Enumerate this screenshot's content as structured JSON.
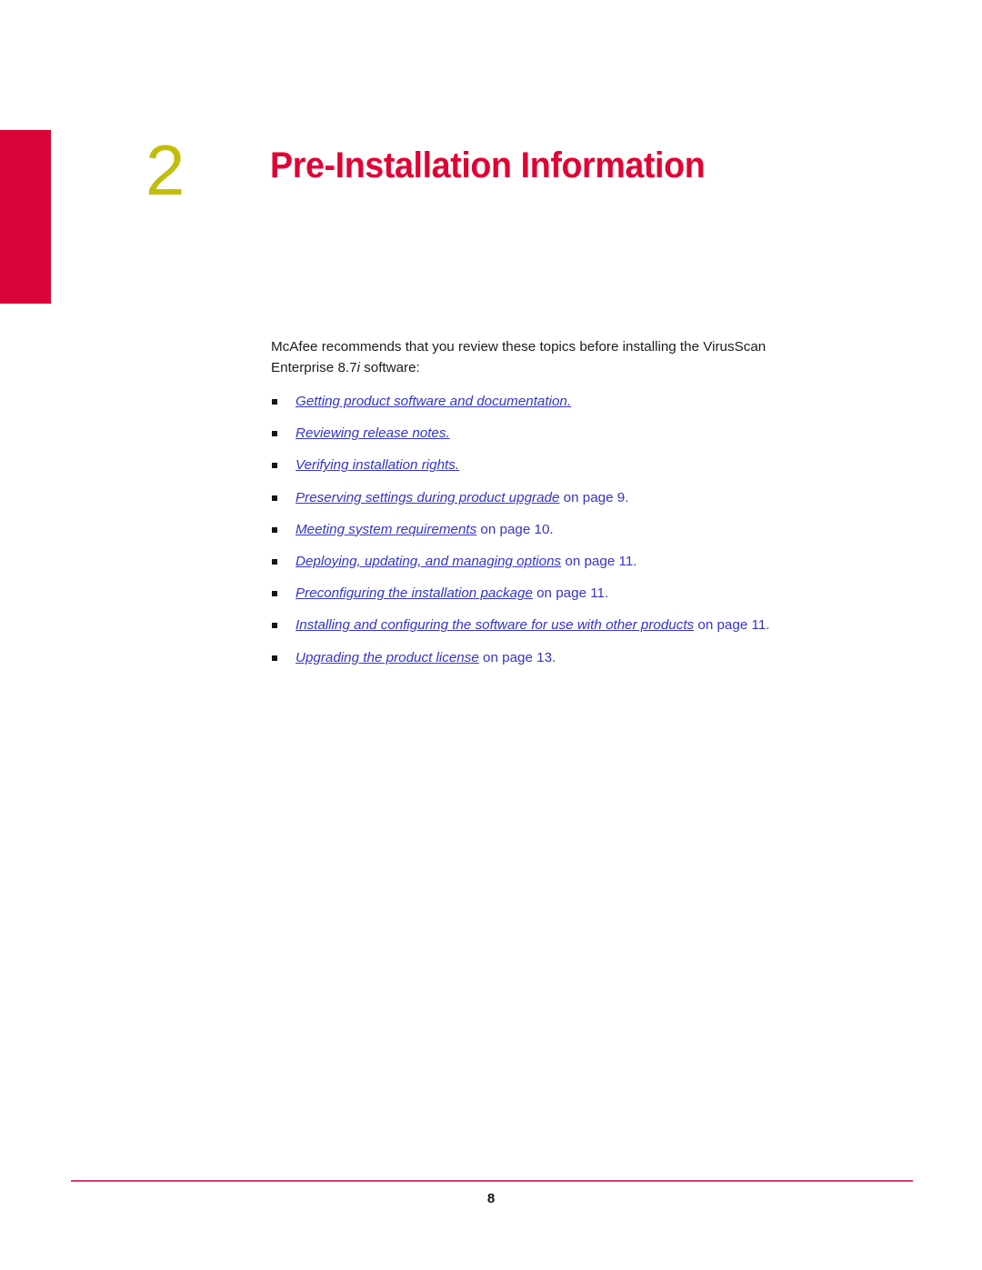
{
  "document": {
    "page_number": "8"
  },
  "chapter": {
    "number": "2",
    "title": "Pre-Installation Information",
    "accent_color": "#d80437",
    "number_color": "#c2bd08",
    "title_color": "#e00234"
  },
  "intro": {
    "text_part_1": "McAfee recommends that you review these topics before installing the VirusScan Enterprise 8.7",
    "text_italic": "i",
    "text_part_2": " software:"
  },
  "topics": [
    {
      "title": "Getting product software and documentation.",
      "suffix": ""
    },
    {
      "title": "Reviewing release notes.",
      "suffix": ""
    },
    {
      "title": "Verifying installation rights.",
      "suffix": ""
    },
    {
      "title": "Preserving settings during product upgrade",
      "suffix": " on page 9."
    },
    {
      "title": "Meeting system requirements",
      "suffix": " on page 10."
    },
    {
      "title": "Deploying, updating, and managing options",
      "suffix": " on page 11."
    },
    {
      "title": "Preconfiguring the installation package",
      "suffix": " on page 11."
    },
    {
      "title": "Installing and configuring the software for use with other products",
      "suffix": " on page 11."
    },
    {
      "title": "Upgrading the product license",
      "suffix": " on page 13."
    }
  ],
  "colors": {
    "link": "#3434cc",
    "body_text": "#1c1c1c",
    "footer_rule": "#e0386b",
    "bullet_marker": "#161616"
  }
}
